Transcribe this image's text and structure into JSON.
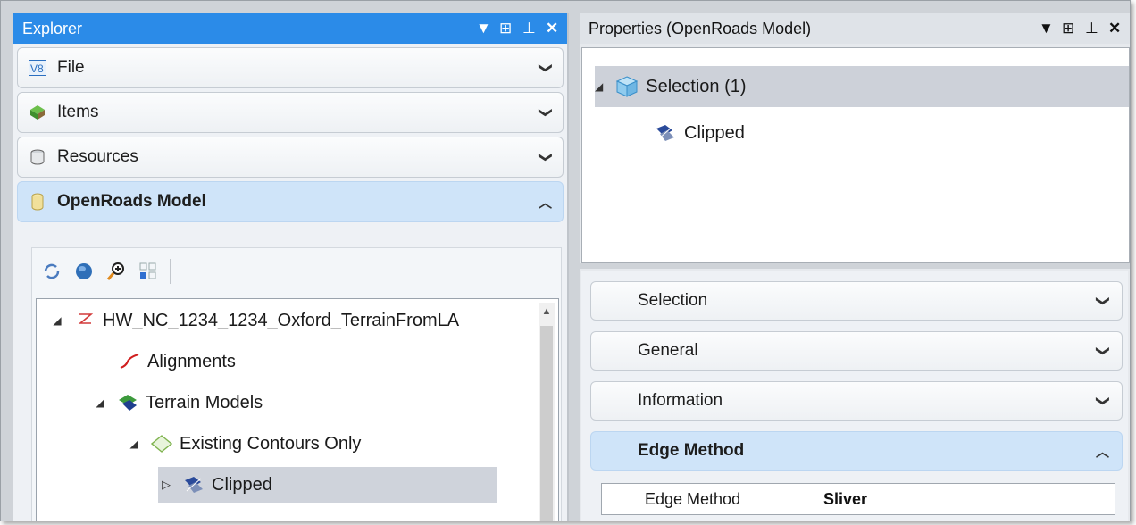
{
  "explorer": {
    "title": "Explorer",
    "accordion": [
      {
        "label": "File",
        "icon": "v8-file-icon"
      },
      {
        "label": "Items",
        "icon": "items-icon"
      },
      {
        "label": "Resources",
        "icon": "resources-icon"
      },
      {
        "label": "OpenRoads Model",
        "icon": "openroads-model-icon",
        "expanded": true
      }
    ],
    "toolbar": [
      "refresh-icon",
      "globe-icon",
      "zoom-icon",
      "grid-view-icon"
    ],
    "tree": [
      {
        "label": "HW_NC_1234_1234_Oxford_TerrainFromLA",
        "icon": "terrain-file-icon",
        "level": 0,
        "expanded": true
      },
      {
        "label": "Alignments",
        "icon": "alignments-icon",
        "level": 1
      },
      {
        "label": "Terrain Models",
        "icon": "terrain-models-icon",
        "level": 1,
        "expanded": true
      },
      {
        "label": "Existing Contours Only",
        "icon": "terrain-model-icon",
        "level": 2,
        "expanded": true
      },
      {
        "label": "Clipped",
        "icon": "clipped-terrain-icon",
        "level": 3,
        "collapsed": true,
        "selected": true
      }
    ]
  },
  "properties": {
    "title": "Properties (OpenRoads Model)",
    "selection_root": "Selection (1)",
    "selection_child": "Clipped",
    "sections": [
      {
        "label": "Selection"
      },
      {
        "label": "General"
      },
      {
        "label": "Information"
      },
      {
        "label": "Edge Method",
        "expanded": true
      }
    ],
    "grid": {
      "name": "Edge Method",
      "value": "Sliver"
    }
  },
  "colors": {
    "accent": "#2b8be8",
    "expanded_header": "#cfe4f9",
    "selection": "#cfd3db"
  }
}
